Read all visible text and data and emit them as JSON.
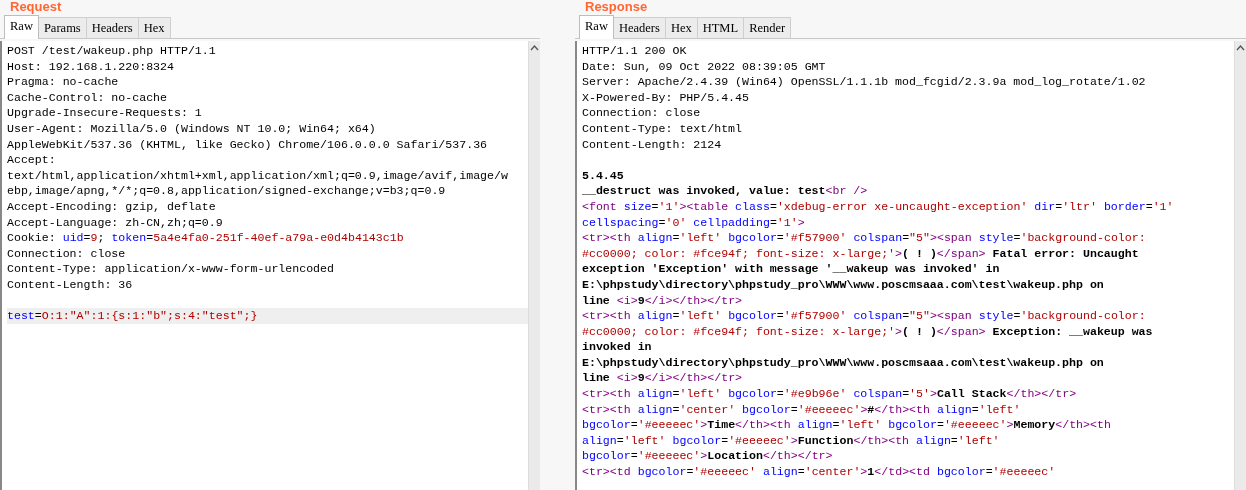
{
  "request": {
    "title": "Request",
    "tabs": [
      {
        "label": "Raw",
        "selected": true
      },
      {
        "label": "Params",
        "selected": false
      },
      {
        "label": "Headers",
        "selected": false
      },
      {
        "label": "Hex",
        "selected": false
      }
    ],
    "sections": [
      {
        "highlighted": false,
        "lines": [
          [
            {
              "kind": "plain",
              "text": "POST /test/wakeup.php HTTP/1.1"
            }
          ],
          [
            {
              "kind": "plain",
              "text": "Host: 192.168.1.220:8324"
            }
          ],
          [
            {
              "kind": "plain",
              "text": "Pragma: no-cache"
            }
          ],
          [
            {
              "kind": "plain",
              "text": "Cache-Control: no-cache"
            }
          ],
          [
            {
              "kind": "plain",
              "text": "Upgrade-Insecure-Requests: 1"
            }
          ],
          [
            {
              "kind": "plain",
              "text": "User-Agent: Mozilla/5.0 (Windows NT 10.0; Win64; x64)"
            }
          ],
          [
            {
              "kind": "plain",
              "text": "AppleWebKit/537.36 (KHTML, like Gecko) Chrome/106.0.0.0 Safari/537.36"
            }
          ],
          [
            {
              "kind": "plain",
              "text": "Accept:"
            }
          ],
          [
            {
              "kind": "plain",
              "text": "text/html,application/xhtml+xml,application/xml;q=0.9,image/avif,image/w"
            }
          ],
          [
            {
              "kind": "plain",
              "text": "ebp,image/apng,*/*;q=0.8,application/signed-exchange;v=b3;q=0.9"
            }
          ],
          [
            {
              "kind": "plain",
              "text": "Accept-Encoding: gzip, deflate"
            }
          ],
          [
            {
              "kind": "plain",
              "text": "Accept-Language: zh-CN,zh;q=0.9"
            }
          ],
          [
            {
              "kind": "plain",
              "text": "Cookie: "
            },
            {
              "kind": "name",
              "text": "uid"
            },
            {
              "kind": "plain",
              "text": "="
            },
            {
              "kind": "value",
              "text": "9"
            },
            {
              "kind": "plain",
              "text": "; "
            },
            {
              "kind": "name",
              "text": "token"
            },
            {
              "kind": "plain",
              "text": "="
            },
            {
              "kind": "value",
              "text": "5a4e4fa0-251f-40ef-a79a-e0d4b4143c1b"
            }
          ],
          [
            {
              "kind": "plain",
              "text": "Connection: close"
            }
          ],
          [
            {
              "kind": "plain",
              "text": "Content-Type: application/x-www-form-urlencoded"
            }
          ],
          [
            {
              "kind": "plain",
              "text": "Content-Length: 36"
            }
          ]
        ]
      },
      {
        "highlighted": true,
        "lines": [
          [
            {
              "kind": "name",
              "text": "test"
            },
            {
              "kind": "plain",
              "text": "="
            },
            {
              "kind": "value",
              "text": "O:1:\"A\":1:{s:1:\"b\";s:4:\"test\";}"
            }
          ]
        ]
      }
    ]
  },
  "response": {
    "title": "Response",
    "tabs": [
      {
        "label": "Raw",
        "selected": true
      },
      {
        "label": "Headers",
        "selected": false
      },
      {
        "label": "Hex",
        "selected": false
      },
      {
        "label": "HTML",
        "selected": false
      },
      {
        "label": "Render",
        "selected": false
      }
    ],
    "sections": [
      {
        "highlighted": false,
        "lines": [
          [
            {
              "kind": "plain",
              "text": "HTTP/1.1 200 OK"
            }
          ],
          [
            {
              "kind": "plain",
              "text": "Date: Sun, 09 Oct 2022 08:39:05 GMT"
            }
          ],
          [
            {
              "kind": "plain",
              "text": "Server: Apache/2.4.39 (Win64) OpenSSL/1.1.1b mod_fcgid/2.3.9a mod_log_rotate/1.02"
            }
          ],
          [
            {
              "kind": "plain",
              "text": "X-Powered-By: PHP/5.4.45"
            }
          ],
          [
            {
              "kind": "plain",
              "text": "Connection: close"
            }
          ],
          [
            {
              "kind": "plain",
              "text": "Content-Type: text/html"
            }
          ],
          [
            {
              "kind": "plain",
              "text": "Content-Length: 2124"
            }
          ]
        ]
      },
      {
        "highlighted": false,
        "lines": [
          [
            {
              "kind": "bold",
              "text": "5.4.45"
            }
          ],
          [
            {
              "kind": "bold",
              "text": "__destruct was invoked, value: test"
            },
            {
              "kind": "tag",
              "text": "<br />"
            }
          ],
          [
            {
              "kind": "tag",
              "text": "<font "
            },
            {
              "kind": "attr",
              "text": "size"
            },
            {
              "kind": "plain",
              "text": "="
            },
            {
              "kind": "val",
              "text": "'1'"
            },
            {
              "kind": "tag",
              "text": "><table "
            },
            {
              "kind": "attr",
              "text": "class"
            },
            {
              "kind": "plain",
              "text": "="
            },
            {
              "kind": "val",
              "text": "'xdebug-error xe-uncaught-exception'"
            },
            {
              "kind": "attr",
              "text": " dir"
            },
            {
              "kind": "plain",
              "text": "="
            },
            {
              "kind": "val",
              "text": "'ltr'"
            },
            {
              "kind": "attr",
              "text": " border"
            },
            {
              "kind": "plain",
              "text": "="
            },
            {
              "kind": "val",
              "text": "'1'"
            }
          ],
          [
            {
              "kind": "attr",
              "text": "cellspacing"
            },
            {
              "kind": "plain",
              "text": "="
            },
            {
              "kind": "val",
              "text": "'0'"
            },
            {
              "kind": "attr",
              "text": " cellpadding"
            },
            {
              "kind": "plain",
              "text": "="
            },
            {
              "kind": "val",
              "text": "'1'"
            },
            {
              "kind": "tag",
              "text": ">"
            }
          ],
          [
            {
              "kind": "tag",
              "text": "<tr><th "
            },
            {
              "kind": "attr",
              "text": "align"
            },
            {
              "kind": "plain",
              "text": "="
            },
            {
              "kind": "val",
              "text": "'left'"
            },
            {
              "kind": "attr",
              "text": " bgcolor"
            },
            {
              "kind": "plain",
              "text": "="
            },
            {
              "kind": "val",
              "text": "'#f57900'"
            },
            {
              "kind": "attr",
              "text": " colspan"
            },
            {
              "kind": "plain",
              "text": "="
            },
            {
              "kind": "val",
              "text": "\"5\""
            },
            {
              "kind": "tag",
              "text": "><span "
            },
            {
              "kind": "attr",
              "text": "style"
            },
            {
              "kind": "plain",
              "text": "="
            },
            {
              "kind": "val",
              "text": "'background-color:"
            }
          ],
          [
            {
              "kind": "val",
              "text": "#cc0000; color: #fce94f; font-size: x-large;'"
            },
            {
              "kind": "tag",
              "text": ">"
            },
            {
              "kind": "bold",
              "text": "( ! )"
            },
            {
              "kind": "tag",
              "text": "</span>"
            },
            {
              "kind": "bold",
              "text": " Fatal error: Uncaught"
            }
          ],
          [
            {
              "kind": "bold",
              "text": "exception 'Exception' with message '__wakeup was invoked' in"
            }
          ],
          [
            {
              "kind": "bold",
              "text": "E:\\phpstudy\\directory\\phpstudy_pro\\WWW\\www.poscmsaaa.com\\test\\wakeup.php on"
            }
          ],
          [
            {
              "kind": "bold",
              "text": "line "
            },
            {
              "kind": "tag",
              "text": "<i>"
            },
            {
              "kind": "bold",
              "text": "9"
            },
            {
              "kind": "tag",
              "text": "</i></th></tr>"
            }
          ],
          [
            {
              "kind": "tag",
              "text": "<tr><th "
            },
            {
              "kind": "attr",
              "text": "align"
            },
            {
              "kind": "plain",
              "text": "="
            },
            {
              "kind": "val",
              "text": "'left'"
            },
            {
              "kind": "attr",
              "text": " bgcolor"
            },
            {
              "kind": "plain",
              "text": "="
            },
            {
              "kind": "val",
              "text": "'#f57900'"
            },
            {
              "kind": "attr",
              "text": " colspan"
            },
            {
              "kind": "plain",
              "text": "="
            },
            {
              "kind": "val",
              "text": "\"5\""
            },
            {
              "kind": "tag",
              "text": "><span "
            },
            {
              "kind": "attr",
              "text": "style"
            },
            {
              "kind": "plain",
              "text": "="
            },
            {
              "kind": "val",
              "text": "'background-color:"
            }
          ],
          [
            {
              "kind": "val",
              "text": "#cc0000; color: #fce94f; font-size: x-large;'"
            },
            {
              "kind": "tag",
              "text": ">"
            },
            {
              "kind": "bold",
              "text": "( ! )"
            },
            {
              "kind": "tag",
              "text": "</span>"
            },
            {
              "kind": "bold",
              "text": " Exception: __wakeup was"
            }
          ],
          [
            {
              "kind": "bold",
              "text": "invoked in"
            }
          ],
          [
            {
              "kind": "bold",
              "text": "E:\\phpstudy\\directory\\phpstudy_pro\\WWW\\www.poscmsaaa.com\\test\\wakeup.php on"
            }
          ],
          [
            {
              "kind": "bold",
              "text": "line "
            },
            {
              "kind": "tag",
              "text": "<i>"
            },
            {
              "kind": "bold",
              "text": "9"
            },
            {
              "kind": "tag",
              "text": "</i></th></tr>"
            }
          ],
          [
            {
              "kind": "tag",
              "text": "<tr><th "
            },
            {
              "kind": "attr",
              "text": "align"
            },
            {
              "kind": "plain",
              "text": "="
            },
            {
              "kind": "val",
              "text": "'left'"
            },
            {
              "kind": "attr",
              "text": " bgcolor"
            },
            {
              "kind": "plain",
              "text": "="
            },
            {
              "kind": "val",
              "text": "'#e9b96e'"
            },
            {
              "kind": "attr",
              "text": " colspan"
            },
            {
              "kind": "plain",
              "text": "="
            },
            {
              "kind": "val",
              "text": "'5'"
            },
            {
              "kind": "tag",
              "text": ">"
            },
            {
              "kind": "bold",
              "text": "Call Stack"
            },
            {
              "kind": "tag",
              "text": "</th></tr>"
            }
          ],
          [
            {
              "kind": "tag",
              "text": "<tr><th "
            },
            {
              "kind": "attr",
              "text": "align"
            },
            {
              "kind": "plain",
              "text": "="
            },
            {
              "kind": "val",
              "text": "'center'"
            },
            {
              "kind": "attr",
              "text": " bgcolor"
            },
            {
              "kind": "plain",
              "text": "="
            },
            {
              "kind": "val",
              "text": "'#eeeeec'"
            },
            {
              "kind": "tag",
              "text": ">"
            },
            {
              "kind": "bold",
              "text": "#"
            },
            {
              "kind": "tag",
              "text": "</th><th "
            },
            {
              "kind": "attr",
              "text": "align"
            },
            {
              "kind": "plain",
              "text": "="
            },
            {
              "kind": "val",
              "text": "'left'"
            }
          ],
          [
            {
              "kind": "attr",
              "text": "bgcolor"
            },
            {
              "kind": "plain",
              "text": "="
            },
            {
              "kind": "val",
              "text": "'#eeeeec'"
            },
            {
              "kind": "tag",
              "text": ">"
            },
            {
              "kind": "bold",
              "text": "Time"
            },
            {
              "kind": "tag",
              "text": "</th><th "
            },
            {
              "kind": "attr",
              "text": "align"
            },
            {
              "kind": "plain",
              "text": "="
            },
            {
              "kind": "val",
              "text": "'left'"
            },
            {
              "kind": "attr",
              "text": " bgcolor"
            },
            {
              "kind": "plain",
              "text": "="
            },
            {
              "kind": "val",
              "text": "'#eeeeec'"
            },
            {
              "kind": "tag",
              "text": ">"
            },
            {
              "kind": "bold",
              "text": "Memory"
            },
            {
              "kind": "tag",
              "text": "</th><th"
            }
          ],
          [
            {
              "kind": "attr",
              "text": "align"
            },
            {
              "kind": "plain",
              "text": "="
            },
            {
              "kind": "val",
              "text": "'left'"
            },
            {
              "kind": "attr",
              "text": " bgcolor"
            },
            {
              "kind": "plain",
              "text": "="
            },
            {
              "kind": "val",
              "text": "'#eeeeec'"
            },
            {
              "kind": "tag",
              "text": ">"
            },
            {
              "kind": "bold",
              "text": "Function"
            },
            {
              "kind": "tag",
              "text": "</th><th "
            },
            {
              "kind": "attr",
              "text": "align"
            },
            {
              "kind": "plain",
              "text": "="
            },
            {
              "kind": "val",
              "text": "'left'"
            }
          ],
          [
            {
              "kind": "attr",
              "text": "bgcolor"
            },
            {
              "kind": "plain",
              "text": "="
            },
            {
              "kind": "val",
              "text": "'#eeeeec'"
            },
            {
              "kind": "tag",
              "text": ">"
            },
            {
              "kind": "bold",
              "text": "Location"
            },
            {
              "kind": "tag",
              "text": "</th></tr>"
            }
          ],
          [
            {
              "kind": "tag",
              "text": "<tr><td "
            },
            {
              "kind": "attr",
              "text": "bgcolor"
            },
            {
              "kind": "plain",
              "text": "="
            },
            {
              "kind": "val",
              "text": "'#eeeeec'"
            },
            {
              "kind": "attr",
              "text": " align"
            },
            {
              "kind": "plain",
              "text": "="
            },
            {
              "kind": "val",
              "text": "'center'"
            },
            {
              "kind": "tag",
              "text": ">"
            },
            {
              "kind": "bold",
              "text": "1"
            },
            {
              "kind": "tag",
              "text": "</td><td "
            },
            {
              "kind": "attr",
              "text": "bgcolor"
            },
            {
              "kind": "plain",
              "text": "="
            },
            {
              "kind": "val",
              "text": "'#eeeeec'"
            }
          ]
        ]
      }
    ]
  }
}
